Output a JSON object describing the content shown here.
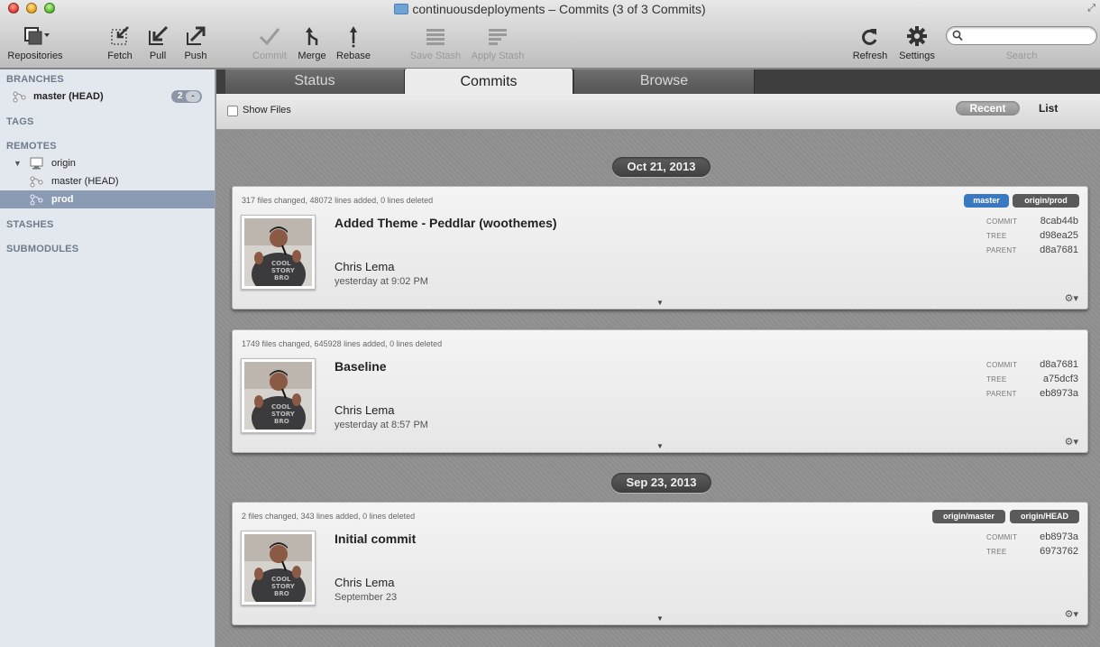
{
  "window": {
    "title": "continuousdeployments – Commits (3 of 3 Commits)"
  },
  "toolbar": {
    "repositories": "Repositories",
    "fetch": "Fetch",
    "pull": "Pull",
    "push": "Push",
    "commit": "Commit",
    "merge": "Merge",
    "rebase": "Rebase",
    "save_stash": "Save Stash",
    "apply_stash": "Apply Stash",
    "refresh": "Refresh",
    "settings": "Settings",
    "search_placeholder": "",
    "search_label": "Search"
  },
  "sidebar": {
    "branches_header": "BRANCHES",
    "branch_master": "master (HEAD)",
    "branch_badge": "2",
    "tags_header": "TAGS",
    "remotes_header": "REMOTES",
    "remote_origin": "origin",
    "remote_master": "master (HEAD)",
    "remote_prod": "prod",
    "stashes_header": "STASHES",
    "submodules_header": "SUBMODULES"
  },
  "tabs": {
    "status": "Status",
    "commits": "Commits",
    "browse": "Browse"
  },
  "subbar": {
    "show_files": "Show Files",
    "recent": "Recent",
    "list": "List"
  },
  "meta_labels": {
    "commit": "COMMIT",
    "tree": "TREE",
    "parent": "PARENT"
  },
  "dates": [
    "Oct 21, 2013",
    "Sep 23, 2013"
  ],
  "commits": [
    {
      "stats": "317 files changed, 48072 lines added, 0 lines deleted",
      "message": "Added Theme - Peddlar (woothemes)",
      "author": "Chris Lema",
      "when": "yesterday at 9:02 PM",
      "commit": "8cab44b",
      "tree": "d98ea25",
      "parent": "d8a7681",
      "tags": [
        "master",
        "origin/prod"
      ]
    },
    {
      "stats": "1749 files changed, 645928 lines added, 0 lines deleted",
      "message": "Baseline",
      "author": "Chris Lema",
      "when": "yesterday at 8:57 PM",
      "commit": "d8a7681",
      "tree": "a75dcf3",
      "parent": "eb8973a",
      "tags": []
    },
    {
      "stats": "2 files changed, 343 lines added, 0 lines deleted",
      "message": "Initial commit",
      "author": "Chris Lema",
      "when": "September 23",
      "commit": "eb8973a",
      "tree": "6973762",
      "tags": [
        "origin/master",
        "origin/HEAD"
      ]
    }
  ],
  "colors": {
    "branch_tag_local": "#3a78c4",
    "branch_tag_remote": "#5a5a5a",
    "sidebar_selection": "#8b9bb4"
  },
  "icons": [
    "repositories-icon",
    "fetch-icon",
    "pull-icon",
    "push-icon",
    "commit-icon",
    "merge-icon",
    "rebase-icon",
    "save-stash-icon",
    "apply-stash-icon",
    "refresh-icon",
    "settings-icon",
    "search-icon",
    "branch-icon",
    "remote-icon",
    "gear-icon",
    "expand-icon"
  ]
}
